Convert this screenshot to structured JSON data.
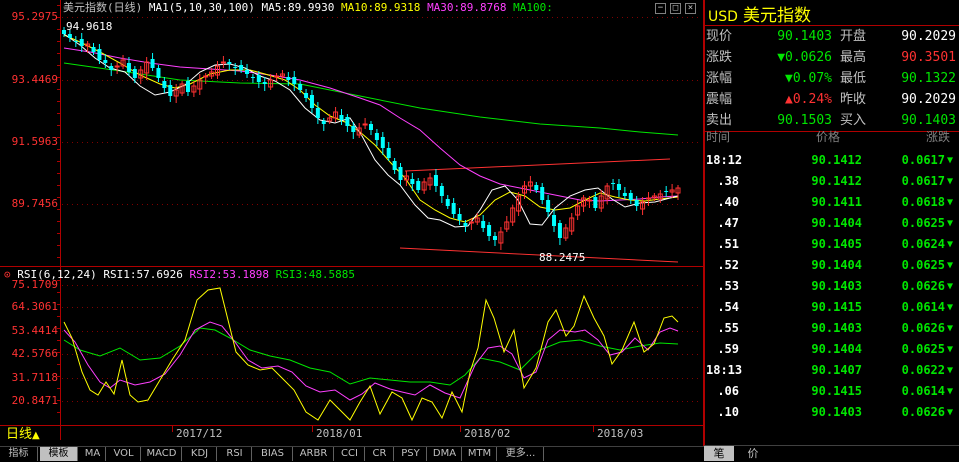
{
  "main_legend": {
    "title": "美元指数(日线)",
    "ma1_label": "MA1(5,10,30,100)",
    "ma5_label": "MA5:89.9930",
    "ma10_label": "MA10:89.9318",
    "ma30_label": "MA30:89.8768",
    "ma100_label": "MA100:"
  },
  "price_axis": [
    "95.2975",
    "93.4469",
    "91.5963",
    "89.7456"
  ],
  "annotations": {
    "high": "94.9618",
    "low": "88.2475"
  },
  "rsi_legend": {
    "title": "RSI(6,12,24)",
    "rsi1": "RSI1:57.6926",
    "rsi2": "RSI2:53.1898",
    "rsi3": "RSI3:48.5885"
  },
  "rsi_axis": [
    "75.1709",
    "64.3061",
    "53.4414",
    "42.5766",
    "31.7118",
    "20.8471"
  ],
  "period_label": "日线",
  "x_axis": [
    "2017/12",
    "2018/01",
    "2018/02",
    "2018/03"
  ],
  "tabs": [
    "指标",
    "模板",
    "MA",
    "VOL",
    "MACD",
    "KDJ",
    "RSI",
    "BIAS",
    "ARBR",
    "CCI",
    "CR",
    "PSY",
    "DMA",
    "MTM",
    "更多..."
  ],
  "panel": {
    "code": "USD",
    "name": "美元指数",
    "quotes": [
      {
        "l1": "现价",
        "v1": "90.1403",
        "c1": "green",
        "l2": "开盘",
        "v2": "90.2029",
        "c2": "white"
      },
      {
        "l1": "涨跌",
        "v1": "▼0.0626",
        "c1": "green",
        "l2": "最高",
        "v2": "90.3501",
        "c2": "red"
      },
      {
        "l1": "涨幅",
        "v1": "▼0.07%",
        "c1": "green",
        "l2": "最低",
        "v2": "90.1322",
        "c2": "green"
      },
      {
        "l1": "震幅",
        "v1": "▲0.24%",
        "c1": "red",
        "l2": "昨收",
        "v2": "90.2029",
        "c2": "white"
      },
      {
        "l1": "卖出",
        "v1": "90.1503",
        "c1": "green",
        "l2": "买入",
        "v2": "90.1403",
        "c2": "green"
      }
    ],
    "tick_headers": [
      "时间",
      "价格",
      "涨跌"
    ],
    "ticks": [
      {
        "time": "18:12",
        "price": "90.1412",
        "change": "0.0617"
      },
      {
        "time": ".38",
        "price": "90.1412",
        "change": "0.0617"
      },
      {
        "time": ".40",
        "price": "90.1411",
        "change": "0.0618"
      },
      {
        "time": ".47",
        "price": "90.1404",
        "change": "0.0625"
      },
      {
        "time": ".51",
        "price": "90.1405",
        "change": "0.0624"
      },
      {
        "time": ".52",
        "price": "90.1404",
        "change": "0.0625"
      },
      {
        "time": ".53",
        "price": "90.1403",
        "change": "0.0626"
      },
      {
        "time": ".54",
        "price": "90.1415",
        "change": "0.0614"
      },
      {
        "time": ".55",
        "price": "90.1403",
        "change": "0.0626"
      },
      {
        "time": ".59",
        "price": "90.1404",
        "change": "0.0625"
      },
      {
        "time": "18:13",
        "price": "90.1407",
        "change": "0.0622"
      },
      {
        "time": ".06",
        "price": "90.1415",
        "change": "0.0614"
      },
      {
        "time": ".10",
        "price": "90.1403",
        "change": "0.0626"
      }
    ],
    "bottom_tabs": [
      "笔",
      "价"
    ]
  },
  "colors": {
    "ma5": "#ffffff",
    "ma10": "#ffff00",
    "ma30": "#ff40ff",
    "ma100": "#00e600",
    "up": "#ff3232",
    "down": "#00ffff",
    "grid": "#800000"
  }
}
